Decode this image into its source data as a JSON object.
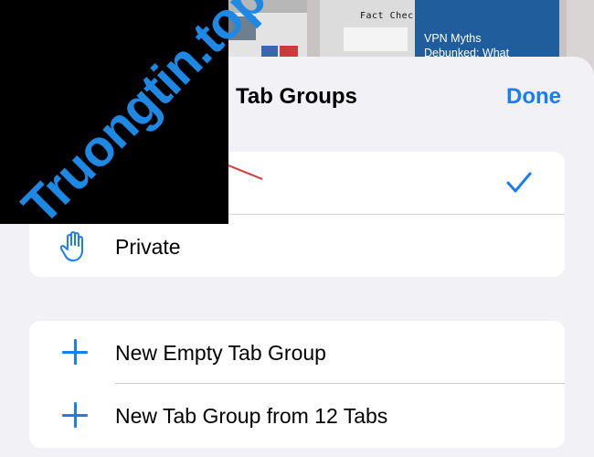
{
  "background_tabs": {
    "right_thumb_photo_text": "Fact Chec",
    "right_thumb_title_line1": "VPN Myths",
    "right_thumb_title_line2": "Debunked: What"
  },
  "sheet": {
    "title": "Tab Groups",
    "done_label": "Done"
  },
  "groups_card": {
    "rows": [
      {
        "label": "",
        "icon": "tabs-icon",
        "selected": true
      },
      {
        "label": "Private",
        "icon": "hand-icon",
        "selected": false
      }
    ]
  },
  "new_card": {
    "rows": [
      {
        "label": "New Empty Tab Group",
        "icon": "plus-icon"
      },
      {
        "label": "New Tab Group from 12 Tabs",
        "icon": "plus-icon"
      }
    ]
  },
  "watermark": {
    "text": "Truongtin.top"
  },
  "colors": {
    "accent": "#1a7ef0",
    "sheet_bg": "#f1f1f6",
    "card_bg": "#ffffff",
    "watermark": "#1e88e5"
  }
}
